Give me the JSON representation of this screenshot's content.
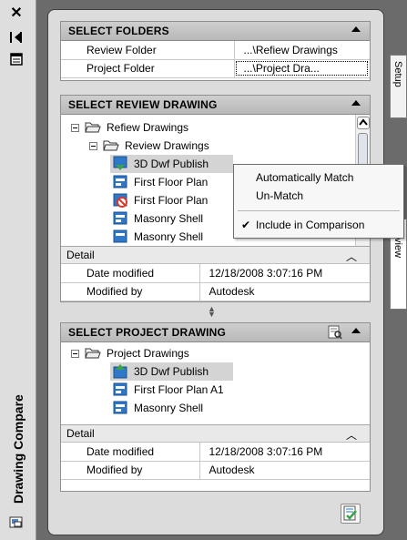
{
  "palette": {
    "title": "Drawing Compare",
    "close_glyph": "✕",
    "pin_glyph": "⇥",
    "menu_glyph": "☰"
  },
  "right_tabs": [
    "Setup",
    "Review"
  ],
  "select_folders": {
    "header": "SELECT FOLDERS",
    "rows": [
      {
        "label": "Review Folder",
        "value": "...\\Refiew Drawings"
      },
      {
        "label": "Project Folder",
        "value": "...\\Project Dra..."
      }
    ]
  },
  "select_review_drawing": {
    "header": "SELECT REVIEW DRAWING",
    "tree": [
      {
        "label": "Refiew Drawings",
        "type": "folder"
      },
      {
        "label": "Review Drawings",
        "type": "folder"
      },
      {
        "label": "3D Dwf Publish",
        "type": "drawing-matched"
      },
      {
        "label": "First Floor Plan",
        "type": "drawing"
      },
      {
        "label": "First Floor Plan",
        "type": "drawing-excluded"
      },
      {
        "label": "Masonry Shell",
        "type": "drawing"
      },
      {
        "label": "Masonry Shell",
        "type": "drawing"
      }
    ],
    "detail": {
      "header": "Detail",
      "rows": [
        {
          "label": "Date modified",
          "value": "12/18/2008 3:07:16 PM"
        },
        {
          "label": "Modified by",
          "value": "Autodesk"
        }
      ]
    }
  },
  "context_menu": {
    "items": [
      {
        "label": "Automatically Match",
        "checked": false
      },
      {
        "label": "Un-Match",
        "checked": false
      },
      {
        "label": "Include in Comparison",
        "checked": true
      }
    ],
    "check_glyph": "✔"
  },
  "select_project_drawing": {
    "header": "SELECT PROJECT DRAWING",
    "tree": [
      {
        "label": "Project Drawings",
        "type": "folder"
      },
      {
        "label": "3D Dwf Publish",
        "type": "drawing-matched"
      },
      {
        "label": "First Floor Plan A1",
        "type": "drawing"
      },
      {
        "label": "Masonry Shell",
        "type": "drawing"
      }
    ],
    "detail": {
      "header": "Detail",
      "rows": [
        {
          "label": "Date modified",
          "value": "12/18/2008 3:07:16 PM"
        },
        {
          "label": "Modified by",
          "value": "Autodesk"
        }
      ]
    }
  },
  "colors": {
    "frame": "#6b6b6b",
    "panel_header": "#c4c4c4",
    "selection": "#d4d4d4",
    "dwg_blue": "#2f78c9",
    "dwg_green": "#3aa34a",
    "exclude_red": "#d63a2e"
  }
}
